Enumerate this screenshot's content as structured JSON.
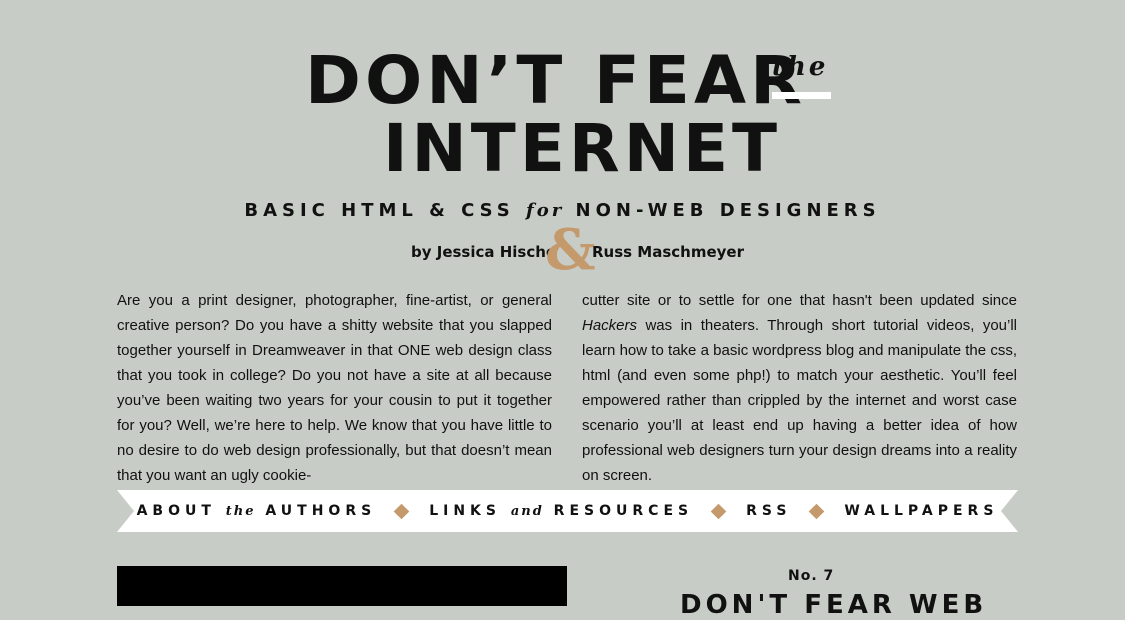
{
  "header": {
    "title_line1": "DON’T FEAR",
    "title_the": "the",
    "title_line2": "INTERNET",
    "subtitle_part1": "BASIC HTML & CSS ",
    "subtitle_for": "for",
    "subtitle_part2": " NON-WEB DESIGNERS",
    "byline_left": "by Jessica Hische",
    "ampersand": "&",
    "byline_right": "Russ Maschmeyer"
  },
  "intro": {
    "left": "Are you a print designer, photographer, fine-artist, or general creative person? Do you have a shitty website that you slapped together yourself in Dreamweaver in that ONE web design class that you took in college? Do you not have a site at all because you’ve been waiting two years for your cousin to put it together for you? Well, we’re here to help. We know that you have little to no desire to do web design professionally, but that doesn’t mean that you want an ugly cookie-",
    "right_before": "cutter site or to settle for one that hasn't been updated since ",
    "right_em": "Hackers",
    "right_after": " was in theaters. Through short tutorial videos, you’ll learn how to take a basic wordpress blog and manipulate the css, html (and even some php!) to match your aesthetic. You’ll feel empowered rather than crippled by the internet and worst case scenario you’ll at least end up having a better idea of how professional web designers turn your design dreams into a reality on screen."
  },
  "nav": {
    "about_1": "ABOUT ",
    "about_the": "the",
    "about_2": " AUTHORS",
    "links_1": "LINKS ",
    "links_and": "and",
    "links_2": " RESOURCES",
    "rss": "RSS",
    "wallpapers": "WALLPAPERS"
  },
  "episode": {
    "number": "No. 7",
    "title": "DON'T FEAR WEB"
  },
  "colors": {
    "background": "#c8ccc6",
    "accent": "#c49a6c",
    "banner": "#ffffff",
    "text": "#111111"
  }
}
